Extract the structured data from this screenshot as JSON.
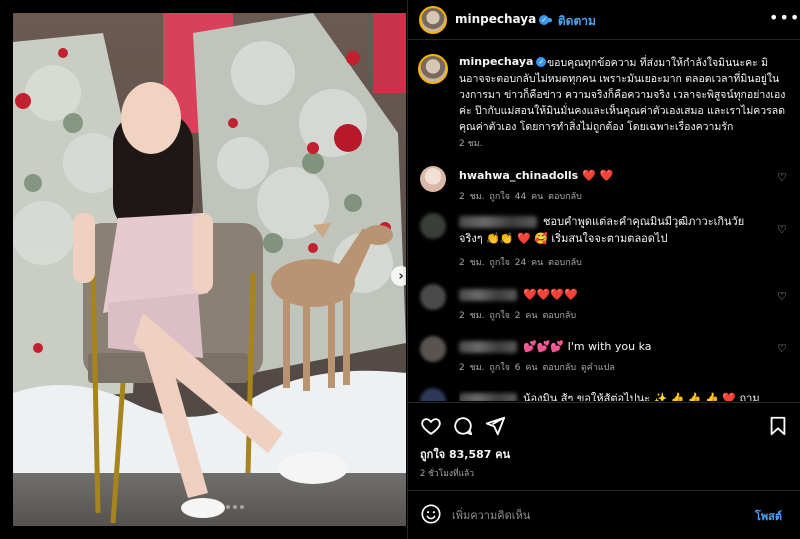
{
  "post": {
    "username": "minpechaya",
    "follow_label": "ติดตาม",
    "more_label": "•••",
    "caption": "ขอบคุณทุกข้อความ ที่ส่งมาให้กำลังใจมินนะคะ มินอาจจะตอบกลับไม่หมดทุกคน เพราะมันเยอะมาก ตลอดเวลาที่มินอยู่ในวงการมา ข่าวก็คือข่าว ความจริงก็คือความจริง เวลาจะพิสูจน์ทุกอย่างเองค่ะ ป๊ากับแม่สอนให้มินมั่นคงและเห็นคุณค่าตัวเองเสมอ และเราไม่ควรลดคุณค่าตัวเอง โดยการทำสิ่งไม่ถูกต้อง โดยเฉพาะเรื่องความรัก",
    "caption_time": "2 ชม.",
    "likes": "ถูกใจ 83,587 คน",
    "posted_ago": "2 ชั่วโมงที่แล้ว"
  },
  "comments": [
    {
      "user": "hwahwa_chinadolls",
      "text": "❤️ ❤️",
      "time": "2 ชม.",
      "likes": "ถูกใจ 44 คน",
      "reply": "ตอบกลับ",
      "hidden_user": false
    },
    {
      "user": "",
      "text": "ชอบคำพูดแต่ละคำคุณมินมีวุฒิภาวะเกินวัยจริงๆ 👏👏 ❤️ 🥰 เริ่มสนใจจะตามตลอดไป",
      "time": "2 ชม.",
      "likes": "ถูกใจ 24 คน",
      "reply": "ตอบกลับ",
      "hidden_user": true
    },
    {
      "user": "",
      "text": "❤️❤️❤️❤️",
      "time": "2 ชม.",
      "likes": "ถูกใจ 2 คน",
      "reply": "ตอบกลับ",
      "hidden_user": true
    },
    {
      "user": "",
      "text": "💕💕💕 I'm with you ka",
      "time": "2 ชม.",
      "likes": "ถูกใจ 6 คน",
      "reply": "ตอบกลับ",
      "extra": "ดูคำแปล",
      "hidden_user": true
    },
    {
      "user": "",
      "text": "น้องมิน สู้ๆ ขอให้สู้ต่อไปนะ ✨ 👍 👍 👍 ❤️ ถามหนี",
      "time": "",
      "likes": "",
      "reply": "",
      "hidden_user": true
    }
  ],
  "composer": {
    "placeholder": "เพิ่มความคิดเห็น",
    "post_label": "โพสต์"
  },
  "colors": {
    "accent": "#4aa3f5",
    "heart": "#ed2b45",
    "muted": "#a8a8a8"
  },
  "icons": [
    "heart-icon",
    "comment-icon",
    "share-icon",
    "bookmark-icon",
    "emoji-icon",
    "verified-icon",
    "more-icon",
    "chevron-right-icon"
  ]
}
